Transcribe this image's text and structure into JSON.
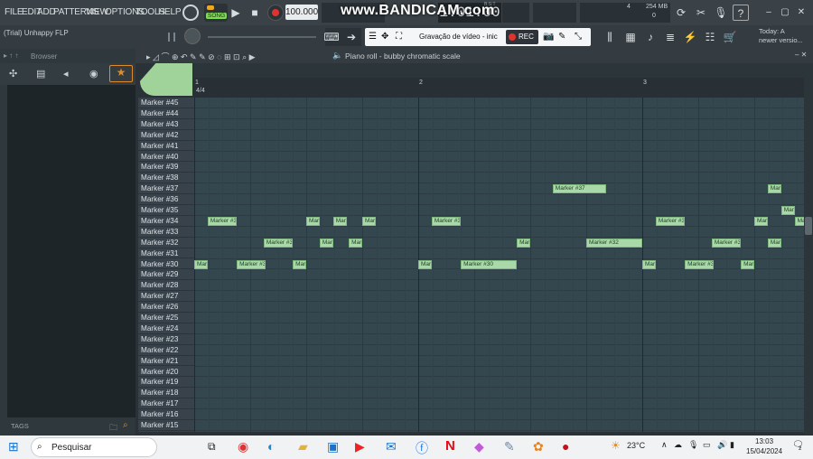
{
  "menu": [
    "FILE",
    "EDIT",
    "ADD",
    "PATTERNS",
    "VIEW",
    "OPTIONS",
    "TOOLS",
    "HELP"
  ],
  "transport": {
    "mode": "SONG",
    "tempo": "100.000",
    "time": "1:01:00",
    "bst": "B:S:T"
  },
  "watermark": "www.BANDICAM.com",
  "recording": {
    "title": "Gravação de vídeo - inic",
    "rec": "REC"
  },
  "info": {
    "pattern": "4",
    "memory": "254 MB",
    "cpu": "0"
  },
  "news": {
    "line1": "Today: A",
    "line2": "newer versio..."
  },
  "project_title": "(Trial) Unhappy FLP",
  "browser": {
    "title": "Browser",
    "tags": "TAGS"
  },
  "piano_roll": {
    "title": "Piano roll - bubby chromatic scale",
    "bars": [
      "1",
      "2",
      "3"
    ],
    "time_sig": "4/4"
  },
  "keys": [
    "Marker #45",
    "Marker #44",
    "Marker #43",
    "Marker #42",
    "Marker #41",
    "Marker #40",
    "Marker #39",
    "Marker #38",
    "Marker #37",
    "Marker #36",
    "Marker #35",
    "Marker #34",
    "Marker #33",
    "Marker #32",
    "Marker #31",
    "Marker #30",
    "Marker #29",
    "Marker #28",
    "Marker #27",
    "Marker #26",
    "Marker #25",
    "Marker #24",
    "Marker #23",
    "Marker #22",
    "Marker #21",
    "Marker #20",
    "Marker #19",
    "Marker #18",
    "Marker #17",
    "Marker #16",
    "Marker #15"
  ],
  "notes": [
    {
      "label": "Marker #37",
      "row": 8,
      "start": 1.6,
      "len": 0.24
    },
    {
      "label": "Mar.",
      "row": 8,
      "start": 2.56,
      "len": 0.06
    },
    {
      "label": "Mar.",
      "row": 10,
      "start": 2.62,
      "len": 0.06
    },
    {
      "label": "Marker #34",
      "row": 11,
      "start": 0.06,
      "len": 0.13
    },
    {
      "label": "Mar.",
      "row": 11,
      "start": 0.5,
      "len": 0.06
    },
    {
      "label": "Mar.",
      "row": 11,
      "start": 0.62,
      "len": 0.06
    },
    {
      "label": "Mar.",
      "row": 11,
      "start": 0.75,
      "len": 0.06
    },
    {
      "label": "Marker #34",
      "row": 11,
      "start": 1.06,
      "len": 0.13
    },
    {
      "label": "Mar.",
      "row": 11,
      "start": 2.5,
      "len": 0.06
    },
    {
      "label": "Mar.",
      "row": 11,
      "start": 2.68,
      "len": 0.06
    },
    {
      "label": "Marker #34",
      "row": 11,
      "start": 2.06,
      "len": 0.13
    },
    {
      "label": "Mar.",
      "row": 11,
      "start": 2.5,
      "len": 0.06
    },
    {
      "label": "Mar.",
      "row": 11,
      "start": 2.88,
      "len": 0.06
    },
    {
      "label": "Mar.",
      "row": 11,
      "start": 3.0,
      "len": 0.06
    },
    {
      "label": "Marker #32",
      "row": 13,
      "start": 0.31,
      "len": 0.13
    },
    {
      "label": "Mar.",
      "row": 13,
      "start": 0.56,
      "len": 0.06
    },
    {
      "label": "Mar.",
      "row": 13,
      "start": 0.69,
      "len": 0.06
    },
    {
      "label": "Mar.",
      "row": 13,
      "start": 1.44,
      "len": 0.06
    },
    {
      "label": "Marker #32",
      "row": 13,
      "start": 1.75,
      "len": 0.25
    },
    {
      "label": "Marker #32",
      "row": 13,
      "start": 2.31,
      "len": 0.13
    },
    {
      "label": "Mar.",
      "row": 13,
      "start": 2.56,
      "len": 0.06
    },
    {
      "label": "Mar.",
      "row": 15,
      "start": 0.0,
      "len": 0.06
    },
    {
      "label": "Marker #30",
      "row": 15,
      "start": 0.19,
      "len": 0.13
    },
    {
      "label": "Mar.",
      "row": 15,
      "start": 0.44,
      "len": 0.06
    },
    {
      "label": "Mar.",
      "row": 15,
      "start": 1.0,
      "len": 0.06
    },
    {
      "label": "Marker #30",
      "row": 15,
      "start": 1.19,
      "len": 0.25
    },
    {
      "label": "Mar.",
      "row": 15,
      "start": 2.0,
      "len": 0.06
    },
    {
      "label": "Marker #30",
      "row": 15,
      "start": 2.19,
      "len": 0.13
    },
    {
      "label": "Mar.",
      "row": 15,
      "start": 2.44,
      "len": 0.06
    }
  ],
  "taskbar": {
    "search": "Pesquisar",
    "temp": "23°C",
    "time": "13:03",
    "date": "15/04/2024",
    "notif": "2"
  }
}
